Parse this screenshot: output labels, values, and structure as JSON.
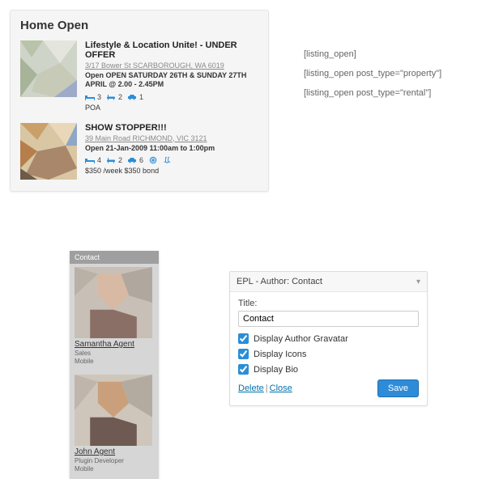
{
  "listing_panel": {
    "heading": "Home Open",
    "items": [
      {
        "title": "Lifestyle & Location Unite! - UNDER OFFER",
        "address": "3/17 Bower St SCARBOROUGH, WA 6019",
        "open": "Open OPEN SATURDAY 26TH & SUNDAY 27TH APRIL @ 2.00 - 2.45PM",
        "beds": "3",
        "baths": "2",
        "cars": "1",
        "price": "POA"
      },
      {
        "title": "SHOW STOPPER!!!",
        "address": "39 Main Road RICHMOND, VIC 3121",
        "open": "Open 21-Jan-2009 11:00am to 1:00pm",
        "beds": "4",
        "baths": "2",
        "cars": "6",
        "price": "$350 /week  $350 bond"
      }
    ]
  },
  "shortcodes": [
    "[listing_open]",
    "[listing_open post_type=\"property\"]",
    "[listing_open post_type=\"rental\"]"
  ],
  "contact_widget": {
    "header": "Contact",
    "agents": [
      {
        "name": "Samantha Agent",
        "role1": "Sales",
        "role2": "Mobile"
      },
      {
        "name": "John Agent",
        "role1": "Plugin Developer",
        "role2": "Mobile"
      }
    ]
  },
  "wp_panel": {
    "bar_prefix": "EPL - Author: ",
    "bar_title": "Contact",
    "field_label": "Title:",
    "field_value": "Contact",
    "checks": [
      {
        "label": "Display Author Gravatar",
        "checked": true
      },
      {
        "label": "Display Icons",
        "checked": true
      },
      {
        "label": "Display Bio",
        "checked": true
      }
    ],
    "link_delete": "Delete",
    "link_close": "Close",
    "save": "Save"
  }
}
